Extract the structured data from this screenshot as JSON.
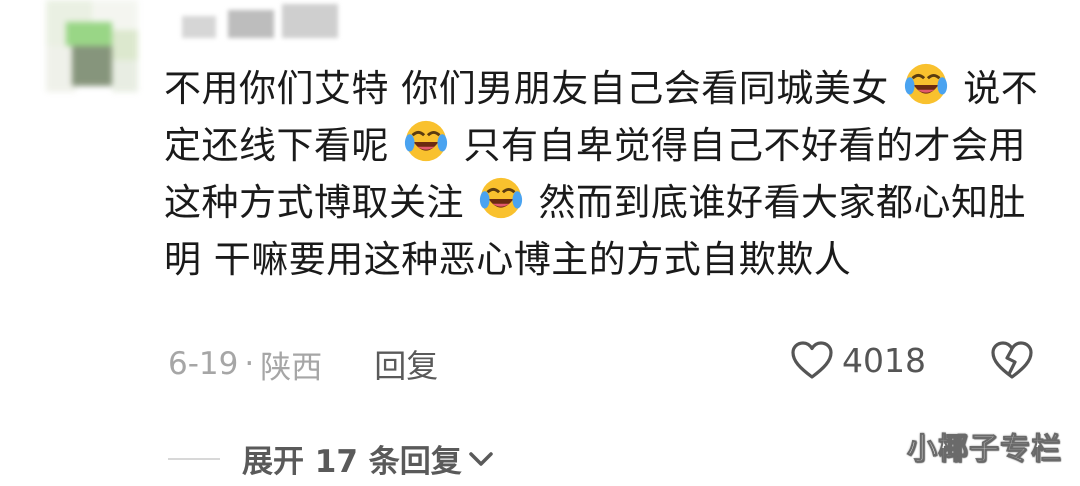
{
  "comment": {
    "segments": [
      "不用你们艾特 你们男朋友自己会看同城美女",
      "说不定还线下看呢",
      "只有自卑觉得自己不好看的才会用这种方式博取关注",
      "然而到底谁好看大家都心知肚明 干嘛要用这种恶心博主的方式自欺欺人"
    ]
  },
  "meta": {
    "date": "6-19",
    "dot": "·",
    "location": "陕西",
    "reply_label": "回复"
  },
  "like": {
    "count": "4018"
  },
  "expand": {
    "label": "展开 17 条回复"
  },
  "watermark": "小椰子专栏",
  "icons": {
    "emoji": "laughing-tears-emoji",
    "like": "heart-icon",
    "dislike": "broken-heart-icon",
    "expand": "chevron-down-icon"
  },
  "colors": {
    "emoji_yellow": "#F9C12E",
    "tear_blue": "#4AA3F0",
    "meta_gray": "#A6A6A6"
  }
}
